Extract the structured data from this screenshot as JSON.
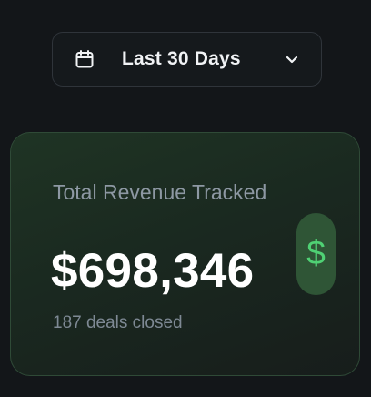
{
  "date_filter": {
    "label": "Last 30 Days",
    "icon": "calendar-icon",
    "dropdown_icon": "chevron-down-icon"
  },
  "revenue_card": {
    "title": "Total Revenue Tracked",
    "value": "$698,346",
    "subtext": "187 deals closed",
    "badge_symbol": "$",
    "accent_color": "#4fd174"
  }
}
